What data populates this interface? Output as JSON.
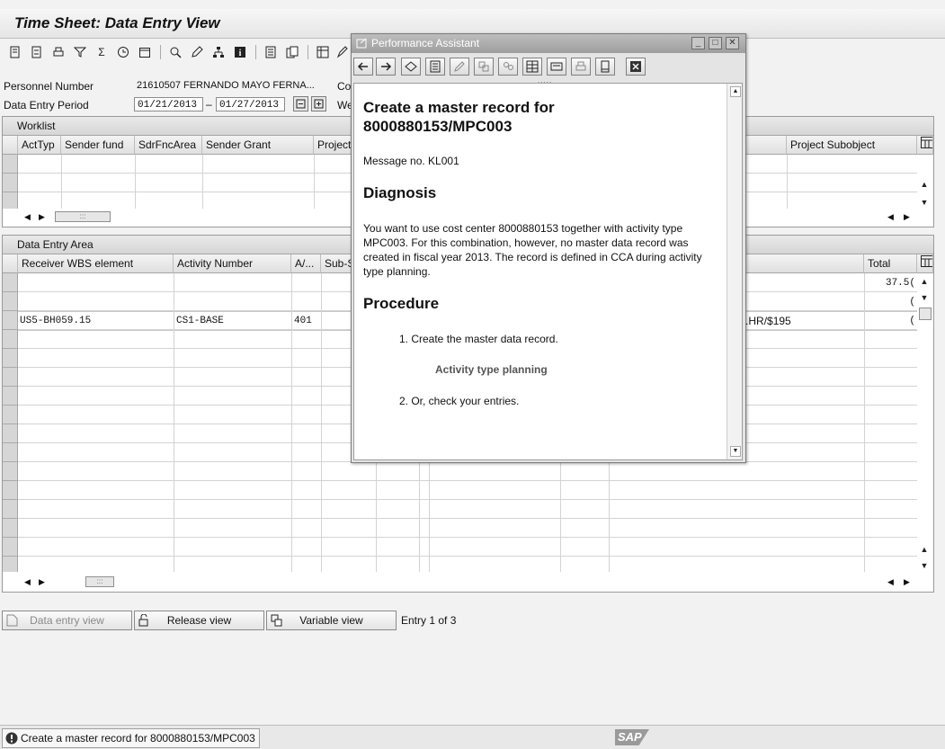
{
  "window": {
    "title": "Time Sheet: Data Entry View"
  },
  "header": {
    "personnel_label": "Personnel Number",
    "personnel_value": "21610507  FERNANDO MAYO FERNA...",
    "personnel_cut": "Co",
    "period_label": "Data Entry Period",
    "period_from": "01/21/2013",
    "period_dash": "–",
    "period_to": "01/27/2013",
    "period_cut": "We"
  },
  "worklist": {
    "title": "Worklist",
    "columns": [
      "ActTyp",
      "Sender fund",
      "SdrFncArea",
      "Sender Grant",
      "Project",
      "Project Subobject"
    ]
  },
  "data_entry": {
    "title": "Data Entry Area",
    "columns": [
      "Receiver WBS element",
      "Activity Number",
      "A/...",
      "Sub-S",
      "Total"
    ],
    "row1_total": "37.5(",
    "row2_total": "(",
    "row3": {
      "wbs": "US5-BH059.15",
      "activity": "CS1-BASE",
      "a": "401",
      "rate": "$195/HR.",
      "total": "("
    }
  },
  "buttons": {
    "data_entry_view": "Data entry view",
    "release_view": "Release view",
    "variable_view": "Variable view",
    "entry_count": "Entry 1 of 3"
  },
  "status": {
    "message": "Create a master record for 8000880153/MPC003",
    "logo": "SAP"
  },
  "popup": {
    "title": "Performance Assistant",
    "heading": "Create a master record for 8000880153/MPC003",
    "message_no": "Message no. KL001",
    "diagnosis_title": "Diagnosis",
    "diagnosis_text": "You want to use cost center 8000880153 together with activity type MPC003. For this combination, however, no master data record was created in fiscal year 2013. The record is defined in CCA during activity type planning.",
    "procedure_title": "Procedure",
    "step1": "1. Create the master data record.",
    "step1_link": "Activity type planning",
    "step2": "2. Or, check your entries."
  }
}
